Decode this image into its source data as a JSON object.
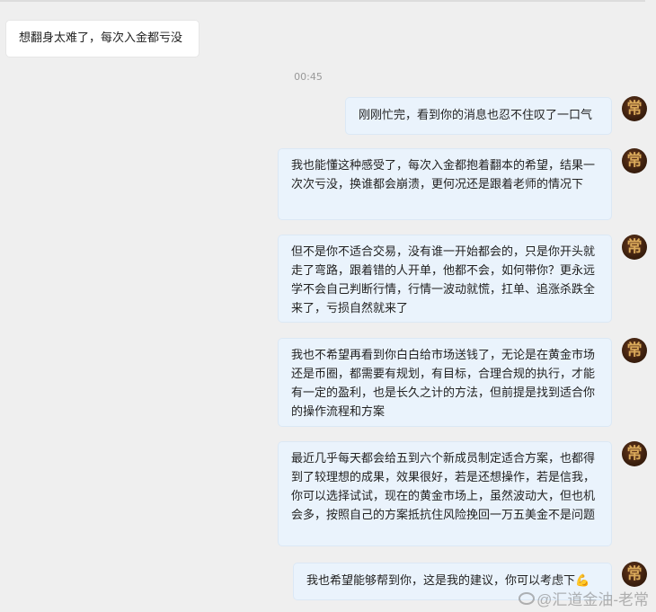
{
  "timestamp": "00:45",
  "messages": [
    {
      "side": "in",
      "text": "想翻身太难了，每次入金都亏没"
    },
    {
      "side": "out",
      "text": "刚刚忙完，看到你的消息也忍不住叹了一口气"
    },
    {
      "side": "out",
      "text": "我也能懂这种感受了，每次入金都抱着翻本的希望，结果一次次亏没，换谁都会崩溃，更何况还是跟着老师的情况下"
    },
    {
      "side": "out",
      "text": "但不是你不适合交易，没有谁一开始都会的，只是你开头就走了弯路，跟着错的人开单，他都不会，如何带你？更永远学不会自己判断行情，行情一波动就慌，扛单、追涨杀跌全来了，亏损自然就来了"
    },
    {
      "side": "out",
      "text": "我也不希望再看到你白白给市场送钱了，无论是在黄金市场还是币圈，都需要有规划，有目标，合理合规的执行，才能有一定的盈利，也是长久之计的方法，但前提是找到适合你的操作流程和方案"
    },
    {
      "side": "out",
      "text": "最近几乎每天都会给五到六个新成员制定适合方案，也都得到了较理想的成果，效果很好，若是还想操作，若是信我，你可以选择试试，现在的黄金市场上，虽然波动大，但也机会多，按照自己的方案抵抗住风险挽回一万五美金不是问题"
    },
    {
      "side": "out",
      "text": "我也希望能够帮到你，这是我的建议，你可以考虑下💪"
    }
  ],
  "avatar_glyph": "常",
  "watermark": "@汇道金油-老常",
  "colors": {
    "background": "#efefef",
    "incoming_bubble": "#ffffff",
    "outgoing_bubble": "#eaf3fc",
    "avatar": "#3b1f0e"
  }
}
